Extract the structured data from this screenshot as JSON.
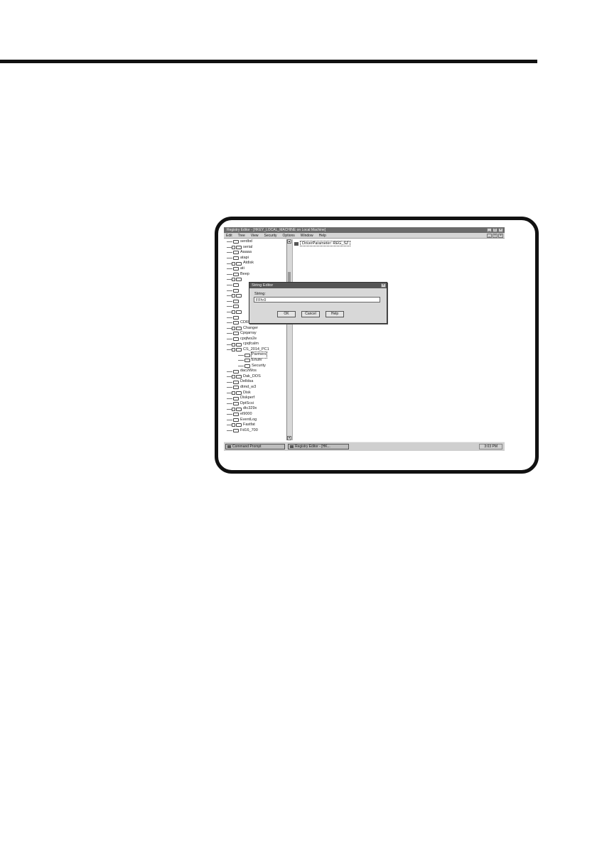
{
  "window": {
    "title": "Registry Editor - [HKEY_LOCAL_MACHINE on Local Machine]"
  },
  "menu": [
    "Edit",
    "Tree",
    "View",
    "Security",
    "Options",
    "Window",
    "Help"
  ],
  "tree": [
    {
      "label": "serdbd",
      "level": 0
    },
    {
      "label": "serial",
      "level": 0
    },
    {
      "label": "Aaaaa",
      "level": 0
    },
    {
      "label": "atapi",
      "level": 0
    },
    {
      "label": "Atdisk",
      "level": 0
    },
    {
      "label": "ati",
      "level": 0
    },
    {
      "label": "Beep",
      "level": 0
    },
    {
      "label": "",
      "level": 0
    },
    {
      "label": "",
      "level": 0
    },
    {
      "label": "",
      "level": 0
    },
    {
      "label": "",
      "level": 0
    },
    {
      "label": "",
      "level": 0
    },
    {
      "label": "",
      "level": 0
    },
    {
      "label": "",
      "level": 0
    },
    {
      "label": "",
      "level": 0
    },
    {
      "label": "CDROM",
      "level": 0
    },
    {
      "label": "Changer",
      "level": 0
    },
    {
      "label": "Cpqarray",
      "level": 0
    },
    {
      "label": "cpqfws2e",
      "level": 0
    },
    {
      "label": "cpqfcalm",
      "level": 0
    },
    {
      "label": "CS_2014_PC1",
      "level": 0
    },
    {
      "label": "Parmers",
      "level": 1,
      "selected": true
    },
    {
      "label": "Enum",
      "level": 1
    },
    {
      "label": "Security",
      "level": 1
    },
    {
      "label": "dac2Wos",
      "level": 0
    },
    {
      "label": "Dak_DOS",
      "level": 0
    },
    {
      "label": "Delldsa",
      "level": 0
    },
    {
      "label": "dtmd_w3",
      "level": 0
    },
    {
      "label": "Disk",
      "level": 0
    },
    {
      "label": "Diskperf",
      "level": 0
    },
    {
      "label": "DptScsi",
      "level": 0
    },
    {
      "label": "dtc329x",
      "level": 0
    },
    {
      "label": "el9000",
      "level": 0
    },
    {
      "label": "EventLog",
      "level": 0
    },
    {
      "label": "Fastfat",
      "level": 0
    },
    {
      "label": "Fd16_700",
      "level": 0
    }
  ],
  "value_pane": {
    "entry": "DriverParameter: REG_SZ"
  },
  "dialog": {
    "title": "String Editor",
    "field_label": "String:",
    "value": "FFh:0",
    "buttons": [
      "OK",
      "Cancel",
      "Help"
    ]
  },
  "taskbar": {
    "items": [
      "Command Prompt",
      "Registry Editor - [HK..."
    ],
    "clock": "3:03 PM"
  },
  "icons": {
    "close": "×",
    "minimize": "_",
    "maximize": "□",
    "scroll_up": "▲",
    "scroll_down": "▼"
  }
}
